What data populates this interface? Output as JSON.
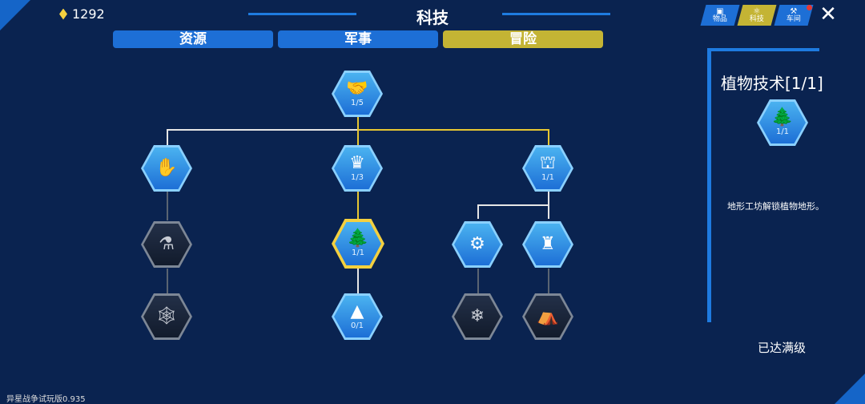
{
  "currency": {
    "amount": "1292",
    "color": "#f4d03f"
  },
  "page_title": "科技",
  "tabs": [
    {
      "label": "资源",
      "state": "normal"
    },
    {
      "label": "军事",
      "state": "normal"
    },
    {
      "label": "冒险",
      "state": "selected"
    }
  ],
  "top_buttons": [
    {
      "label": "物品",
      "icon": "backpack-icon"
    },
    {
      "label": "科技",
      "icon": "atom-icon"
    },
    {
      "label": "车间",
      "icon": "tools-icon"
    }
  ],
  "nodes": [
    {
      "icon": "handshake-icon",
      "glyph": "🤝",
      "level": "1/5",
      "state": "active"
    },
    {
      "icon": "hand-icon",
      "glyph": "✋",
      "level": "",
      "state": "active"
    },
    {
      "icon": "crown-icon",
      "glyph": "♛",
      "level": "1/3",
      "state": "active"
    },
    {
      "icon": "tower-expand-icon",
      "glyph": "⛫",
      "level": "1/1",
      "state": "active"
    },
    {
      "icon": "flask-icon",
      "glyph": "⚗",
      "level": "",
      "state": "locked"
    },
    {
      "icon": "tree-icon",
      "glyph": "🌲",
      "level": "1/1",
      "state": "selected"
    },
    {
      "icon": "wrench-gear-icon",
      "glyph": "⚙",
      "level": "",
      "state": "active"
    },
    {
      "icon": "castle-tower-icon",
      "glyph": "♜",
      "level": "",
      "state": "active"
    },
    {
      "icon": "spiderweb-icon",
      "glyph": "🕸",
      "level": "",
      "state": "locked"
    },
    {
      "icon": "mountain-icon",
      "glyph": "▲",
      "level": "0/1",
      "state": "active"
    },
    {
      "icon": "snowflake-icon",
      "glyph": "❄",
      "level": "",
      "state": "locked"
    },
    {
      "icon": "tent-icon",
      "glyph": "⛺",
      "level": "",
      "state": "locked"
    }
  ],
  "detail_panel": {
    "title": "植物技术[1/1]",
    "icon": "tree-icon",
    "glyph": "🌲",
    "level": "1/1",
    "description": "地形工坊解锁植物地形。",
    "status": "已达满级"
  },
  "version": "异星战争试玩版0.935"
}
